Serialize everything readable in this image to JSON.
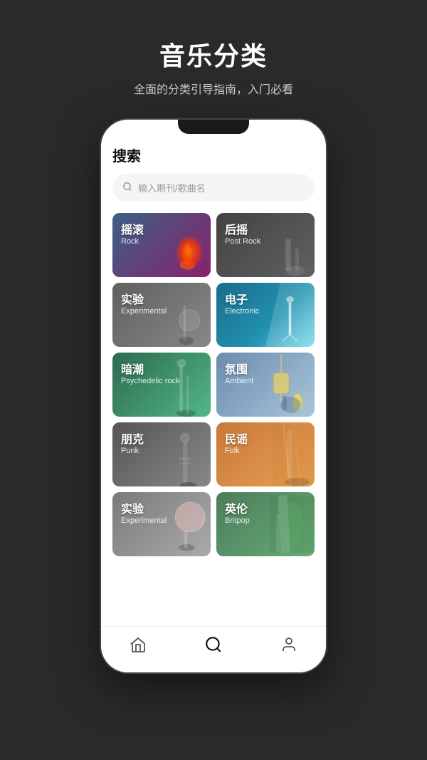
{
  "header": {
    "title": "音乐分类",
    "subtitle": "全面的分类引导指南，入门必看"
  },
  "search": {
    "label": "搜索",
    "placeholder": "输入期刊/歌曲名"
  },
  "categories": [
    {
      "id": "rock",
      "cn": "摇滚",
      "en": "Rock",
      "style": "item-rock"
    },
    {
      "id": "postrock",
      "cn": "后摇",
      "en": "Post Rock",
      "style": "item-postrock"
    },
    {
      "id": "experimental",
      "cn": "实验",
      "en": "Experimental",
      "style": "item-experimental"
    },
    {
      "id": "electronic",
      "cn": "电子",
      "en": "Electronic",
      "style": "item-electronic"
    },
    {
      "id": "psychedelic",
      "cn": "暗潮",
      "en": "Psychedelic rock",
      "style": "item-psychedelic"
    },
    {
      "id": "ambient",
      "cn": "氛围",
      "en": "Ambient",
      "style": "item-ambient"
    },
    {
      "id": "punk",
      "cn": "朋克",
      "en": "Punk",
      "style": "item-punk"
    },
    {
      "id": "folk",
      "cn": "民谣",
      "en": "Folk",
      "style": "item-folk"
    },
    {
      "id": "experimental2",
      "cn": "实验",
      "en": "Experimental",
      "style": "item-experimental2"
    },
    {
      "id": "britpop",
      "cn": "英伦",
      "en": "Britpop",
      "style": "item-britpop"
    }
  ],
  "nav": {
    "items": [
      {
        "id": "home",
        "icon": "ꩠ",
        "label": "home"
      },
      {
        "id": "search",
        "icon": "⊙",
        "label": "search",
        "active": true
      },
      {
        "id": "profile",
        "icon": "⚇",
        "label": "profile"
      }
    ]
  }
}
